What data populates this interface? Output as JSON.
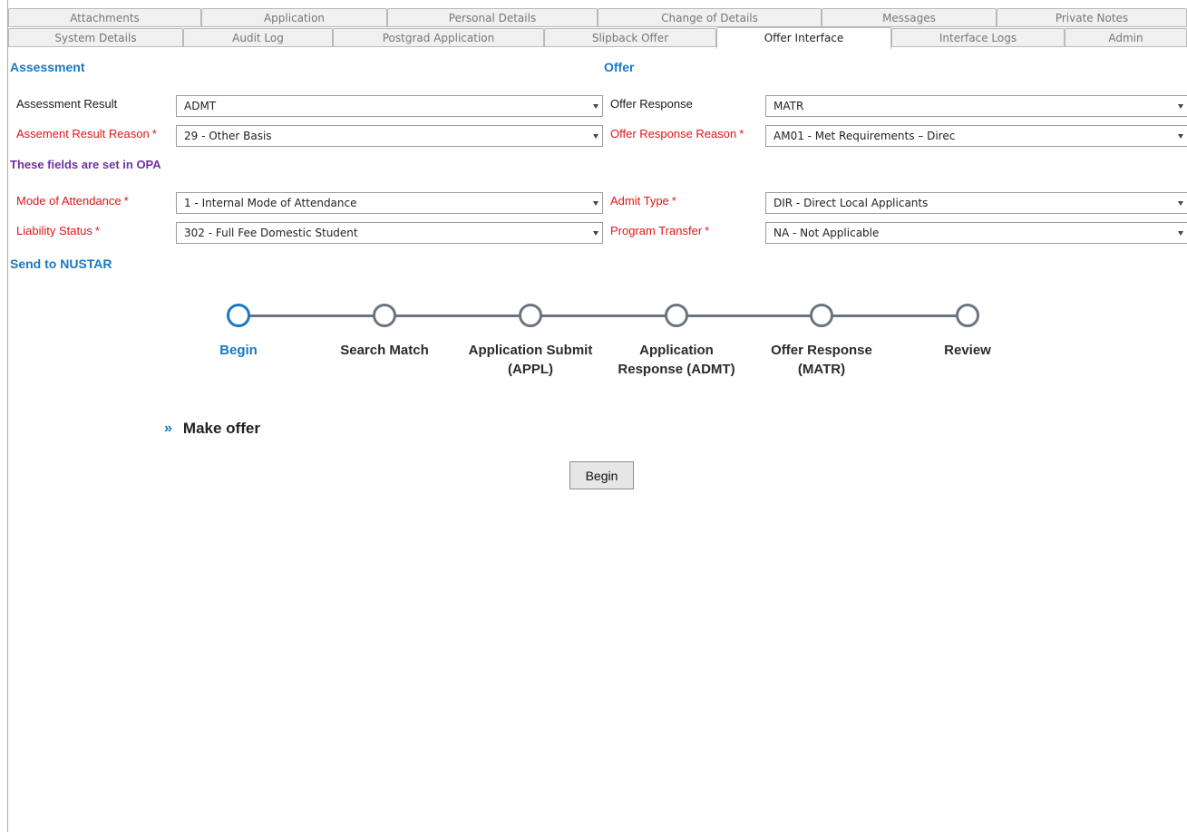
{
  "tabs_row1": [
    {
      "label": "Attachments"
    },
    {
      "label": "Application"
    },
    {
      "label": "Personal Details"
    },
    {
      "label": "Change of Details"
    },
    {
      "label": "Messages"
    },
    {
      "label": "Private Notes"
    }
  ],
  "tabs_row2": [
    {
      "label": "System Details"
    },
    {
      "label": "Audit Log"
    },
    {
      "label": "Postgrad Application"
    },
    {
      "label": "Slipback Offer"
    },
    {
      "label": "Offer Interface",
      "active": true
    },
    {
      "label": "Interface Logs"
    },
    {
      "label": "Admin"
    }
  ],
  "assessment": {
    "title": "Assessment",
    "result_label": "Assessment Result",
    "result_value": "ADMT",
    "reason_label": "Assement Result Reason",
    "reason_value": "29 - Other Basis"
  },
  "offer": {
    "title": "Offer",
    "response_label": "Offer Response",
    "response_value": "MATR",
    "reason_label": "Offer Response Reason",
    "reason_value": "AM01 - Met Requirements – Direc"
  },
  "opa_note": "These fields are set in OPA",
  "opa_fields": {
    "mode_label": "Mode of Attendance",
    "mode_value": "1 - Internal Mode of Attendance",
    "liability_label": "Liability Status",
    "liability_value": "302 - Full Fee Domestic Student",
    "admit_label": "Admit Type",
    "admit_value": "DIR - Direct Local Applicants",
    "transfer_label": "Program Transfer",
    "transfer_value": "NA - Not Applicable"
  },
  "required_marker": "*",
  "send_title": "Send to NUSTAR",
  "steps": [
    {
      "line1": "Begin",
      "line2": "",
      "active": true
    },
    {
      "line1": "Search Match",
      "line2": ""
    },
    {
      "line1": "Application Submit",
      "line2": "(APPL)"
    },
    {
      "line1": "Application",
      "line2": "Response (ADMT)"
    },
    {
      "line1": "Offer Response",
      "line2": "(MATR)"
    },
    {
      "line1": "Review",
      "line2": ""
    }
  ],
  "make_offer": {
    "chevron": "»",
    "label": "Make offer"
  },
  "begin_button": "Begin",
  "colors": {
    "accent": "#1a78c2",
    "required": "#e01515",
    "note": "#7030a0",
    "stepper": "#6c7480"
  }
}
